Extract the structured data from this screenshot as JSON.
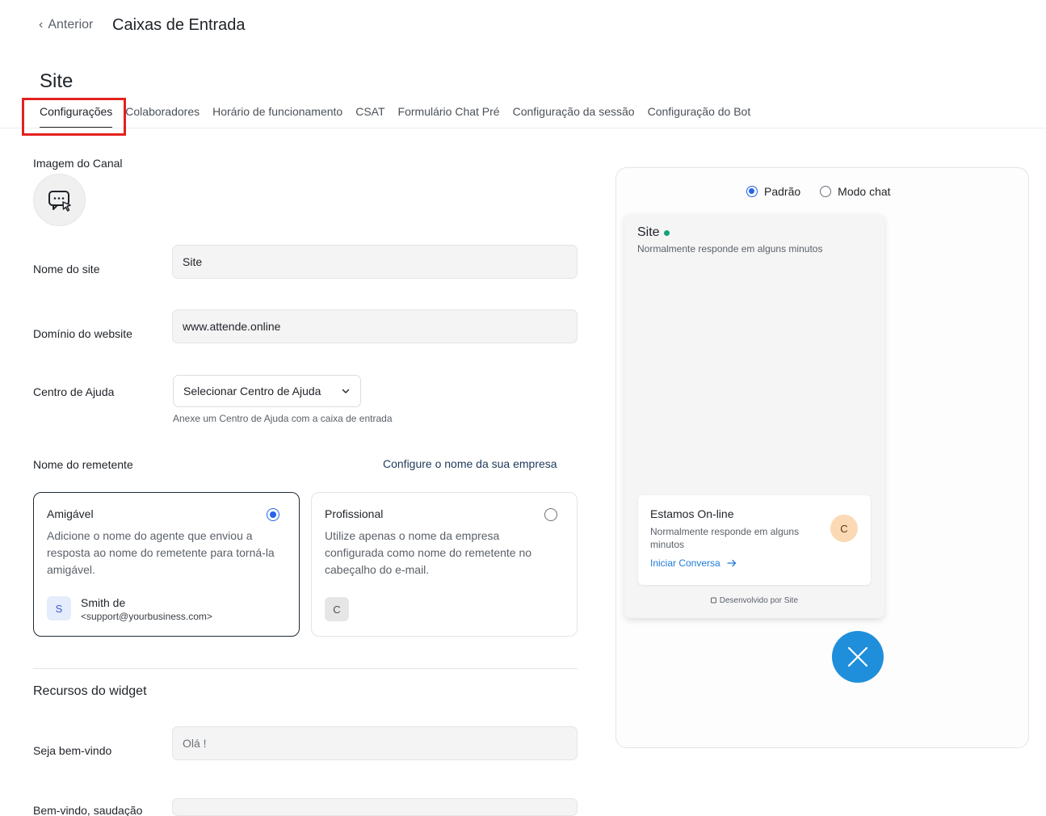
{
  "header": {
    "back_label": "Anterior",
    "page_title": "Caixas de Entrada",
    "inbox_name": "Site"
  },
  "tabs": [
    {
      "label": "Configurações",
      "active": true
    },
    {
      "label": "Colaboradores"
    },
    {
      "label": "Horário de funcionamento"
    },
    {
      "label": "CSAT"
    },
    {
      "label": "Formulário Chat Pré"
    },
    {
      "label": "Configuração da sessão"
    },
    {
      "label": "Configuração do Bot"
    }
  ],
  "form": {
    "channel_image_label": "Imagem do Canal",
    "site_name_label": "Nome do site",
    "site_name_value": "Site",
    "domain_label": "Domínio do website",
    "domain_value": "www.attende.online",
    "help_center_label": "Centro de Ajuda",
    "help_center_select": "Selecionar Centro de Ajuda",
    "help_center_hint": "Anexe um Centro de Ajuda com a caixa de entrada",
    "sender_name_label": "Nome do remetente",
    "configure_link": "Configure o nome da sua empresa",
    "sender_options": [
      {
        "title": "Amigável",
        "description": "Adicione o nome do agente que enviou a resposta ao nome do remetente para torná-la amigável.",
        "avatar_letter": "S",
        "example_name": "Smith de",
        "example_email": "<support@yourbusiness.com>",
        "selected": true
      },
      {
        "title": "Profissional",
        "description": "Utilize apenas o nome da empresa configurada como nome do remetente no cabeçalho do e-mail.",
        "avatar_letter": "C",
        "selected": false
      }
    ],
    "widget_section_title": "Recursos do widget",
    "welcome_label": "Seja bem-vindo",
    "welcome_value": "Olá !",
    "greeting_label": "Bem-vindo, saudação"
  },
  "preview": {
    "mode_default": "Padrão",
    "mode_chat": "Modo chat",
    "selected_mode": "Padrão",
    "widget_title": "Site",
    "widget_subtitle": "Normalmente responde em alguns minutos",
    "conversation_title": "Estamos On-line",
    "conversation_subtitle": "Normalmente responde em alguns minutos",
    "start_conversation": "Iniciar Conversa",
    "agent_letter": "C",
    "powered_by": "Desenvolvido por Site"
  },
  "colors": {
    "accent": "#2563eb",
    "highlight": "#e3211f",
    "fab": "#1f8fdb",
    "online": "#12a37b"
  }
}
